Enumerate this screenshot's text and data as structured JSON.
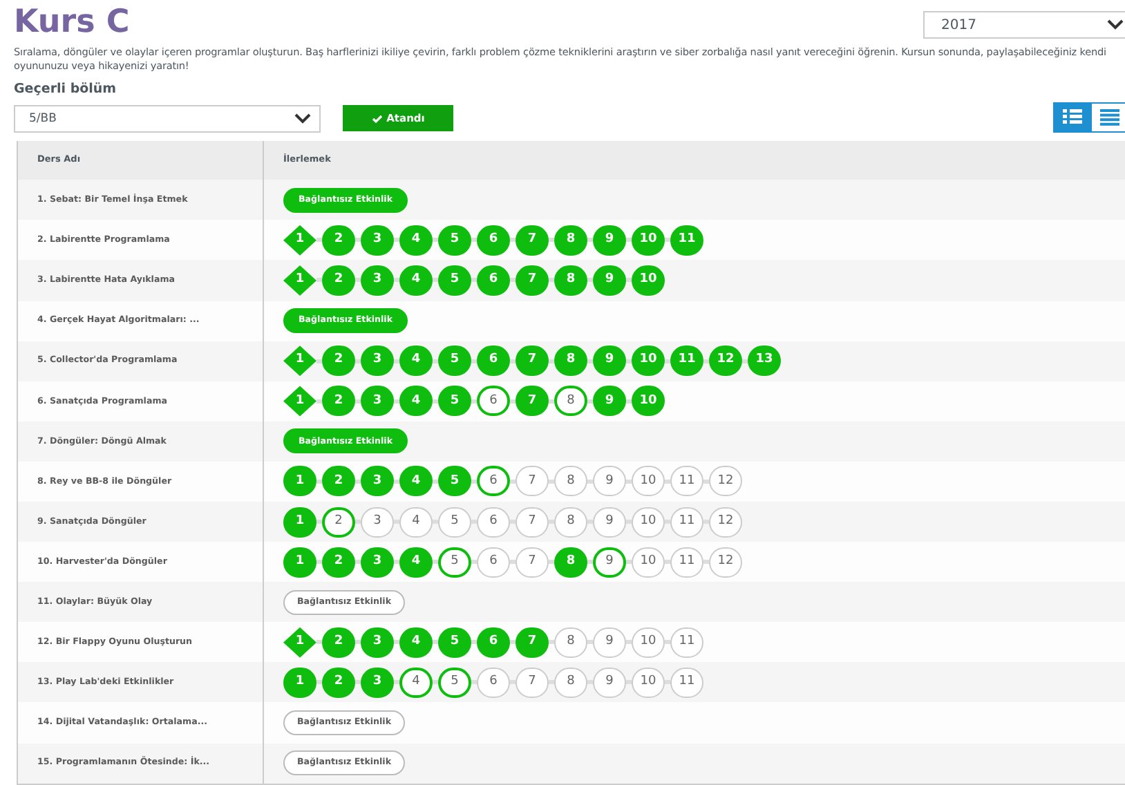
{
  "title": "Kurs C",
  "year_select": {
    "value": "2017"
  },
  "description": "Sıralama, döngüler ve olaylar içeren programlar oluşturun. Baş harflerinizi ikiliye çevirin, farklı problem çözme tekniklerini araştırın ve siber zorbalığa nasıl yanıt vereceğini öğrenin. Kursun sonunda, paylaşabileceğiniz kendi oyununuzu veya hikayenizi yaratın!",
  "section_label": "Geçerli bölüm",
  "section_select": {
    "value": "5/BB"
  },
  "assigned_button": {
    "label": "Atandı"
  },
  "view_toggle": [
    {
      "kind": "detail",
      "selected": true
    },
    {
      "kind": "summary",
      "selected": false
    }
  ],
  "table": {
    "columns": [
      "Ders Adı",
      "İlerlemek"
    ],
    "rows": [
      {
        "name": "1. Sebat: Bir Temel İnşa Etmek",
        "unplugged": {
          "label": "Bağlantısız Etkinlik",
          "completed": true
        }
      },
      {
        "name": "2. Labirentte Programlama",
        "levels": [
          {
            "label": "1",
            "kind": "diamond",
            "completed": true,
            "started": true
          },
          {
            "label": "2",
            "kind": "circle",
            "completed": true,
            "started": true
          },
          {
            "label": "3",
            "kind": "circle",
            "completed": true,
            "started": true
          },
          {
            "label": "4",
            "kind": "circle",
            "completed": true,
            "started": true
          },
          {
            "label": "5",
            "kind": "circle",
            "completed": true,
            "started": true
          },
          {
            "label": "6",
            "kind": "circle",
            "completed": true,
            "started": true
          },
          {
            "label": "7",
            "kind": "circle",
            "completed": true,
            "started": true
          },
          {
            "label": "8",
            "kind": "circle",
            "completed": true,
            "started": true
          },
          {
            "label": "9",
            "kind": "circle",
            "completed": true,
            "started": true
          },
          {
            "label": "10",
            "kind": "circle",
            "completed": true,
            "started": true
          },
          {
            "label": "11",
            "kind": "circle",
            "completed": true,
            "started": true
          }
        ]
      },
      {
        "name": "3. Labirentte Hata Ayıklama",
        "levels": [
          {
            "label": "1",
            "kind": "diamond",
            "completed": true,
            "started": true
          },
          {
            "label": "2",
            "kind": "circle",
            "completed": true,
            "started": true
          },
          {
            "label": "3",
            "kind": "circle",
            "completed": true,
            "started": true
          },
          {
            "label": "4",
            "kind": "circle",
            "completed": true,
            "started": true
          },
          {
            "label": "5",
            "kind": "circle",
            "completed": true,
            "started": true
          },
          {
            "label": "6",
            "kind": "circle",
            "completed": true,
            "started": true
          },
          {
            "label": "7",
            "kind": "circle",
            "completed": true,
            "started": true
          },
          {
            "label": "8",
            "kind": "circle",
            "completed": true,
            "started": true
          },
          {
            "label": "9",
            "kind": "circle",
            "completed": true,
            "started": true
          },
          {
            "label": "10",
            "kind": "circle",
            "completed": true,
            "started": true
          }
        ]
      },
      {
        "name": "4. Gerçek Hayat Algoritmaları: ...",
        "unplugged": {
          "label": "Bağlantısız Etkinlik",
          "completed": true
        }
      },
      {
        "name": "5. Collector'da Programlama",
        "levels": [
          {
            "label": "1",
            "kind": "diamond",
            "completed": true,
            "started": true
          },
          {
            "label": "2",
            "kind": "circle",
            "completed": true,
            "started": true
          },
          {
            "label": "3",
            "kind": "circle",
            "completed": true,
            "started": true
          },
          {
            "label": "4",
            "kind": "circle",
            "completed": true,
            "started": true
          },
          {
            "label": "5",
            "kind": "circle",
            "completed": true,
            "started": true
          },
          {
            "label": "6",
            "kind": "circle",
            "completed": true,
            "started": true
          },
          {
            "label": "7",
            "kind": "circle",
            "completed": true,
            "started": true
          },
          {
            "label": "8",
            "kind": "circle",
            "completed": true,
            "started": true
          },
          {
            "label": "9",
            "kind": "circle",
            "completed": true,
            "started": true
          },
          {
            "label": "10",
            "kind": "circle",
            "completed": true,
            "started": true
          },
          {
            "label": "11",
            "kind": "circle",
            "completed": true,
            "started": true
          },
          {
            "label": "12",
            "kind": "circle",
            "completed": true,
            "started": true
          },
          {
            "label": "13",
            "kind": "circle",
            "completed": true,
            "started": true
          }
        ]
      },
      {
        "name": "6. Sanatçıda Programlama",
        "levels": [
          {
            "label": "1",
            "kind": "diamond",
            "completed": true,
            "started": true
          },
          {
            "label": "2",
            "kind": "circle",
            "completed": true,
            "started": true
          },
          {
            "label": "3",
            "kind": "circle",
            "completed": true,
            "started": true
          },
          {
            "label": "4",
            "kind": "circle",
            "completed": true,
            "started": true
          },
          {
            "label": "5",
            "kind": "circle",
            "completed": true,
            "started": true
          },
          {
            "label": "6",
            "kind": "circle",
            "completed": false,
            "started": true
          },
          {
            "label": "7",
            "kind": "circle",
            "completed": true,
            "started": true
          },
          {
            "label": "8",
            "kind": "circle",
            "completed": false,
            "started": true
          },
          {
            "label": "9",
            "kind": "circle",
            "completed": true,
            "started": true
          },
          {
            "label": "10",
            "kind": "circle",
            "completed": true,
            "started": true
          }
        ]
      },
      {
        "name": "7. Döngüler: Döngü Almak",
        "unplugged": {
          "label": "Bağlantısız Etkinlik",
          "completed": true
        }
      },
      {
        "name": "8. Rey ve BB-8 ile Döngüler",
        "levels": [
          {
            "label": "1",
            "kind": "circle",
            "completed": true,
            "started": true
          },
          {
            "label": "2",
            "kind": "circle",
            "completed": true,
            "started": true
          },
          {
            "label": "3",
            "kind": "circle",
            "completed": true,
            "started": true
          },
          {
            "label": "4",
            "kind": "circle",
            "completed": true,
            "started": true
          },
          {
            "label": "5",
            "kind": "circle",
            "completed": true,
            "started": true
          },
          {
            "label": "6",
            "kind": "circle",
            "completed": false,
            "started": true
          },
          {
            "label": "7",
            "kind": "circle",
            "completed": false,
            "started": false
          },
          {
            "label": "8",
            "kind": "circle",
            "completed": false,
            "started": false
          },
          {
            "label": "9",
            "kind": "circle",
            "completed": false,
            "started": false
          },
          {
            "label": "10",
            "kind": "circle",
            "completed": false,
            "started": false
          },
          {
            "label": "11",
            "kind": "circle",
            "completed": false,
            "started": false
          },
          {
            "label": "12",
            "kind": "circle",
            "completed": false,
            "started": false
          }
        ]
      },
      {
        "name": "9. Sanatçıda Döngüler",
        "levels": [
          {
            "label": "1",
            "kind": "circle",
            "completed": true,
            "started": true
          },
          {
            "label": "2",
            "kind": "circle",
            "completed": false,
            "started": true
          },
          {
            "label": "3",
            "kind": "circle",
            "completed": false,
            "started": false
          },
          {
            "label": "4",
            "kind": "circle",
            "completed": false,
            "started": false
          },
          {
            "label": "5",
            "kind": "circle",
            "completed": false,
            "started": false
          },
          {
            "label": "6",
            "kind": "circle",
            "completed": false,
            "started": false
          },
          {
            "label": "7",
            "kind": "circle",
            "completed": false,
            "started": false
          },
          {
            "label": "8",
            "kind": "circle",
            "completed": false,
            "started": false
          },
          {
            "label": "9",
            "kind": "circle",
            "completed": false,
            "started": false
          },
          {
            "label": "10",
            "kind": "circle",
            "completed": false,
            "started": false
          },
          {
            "label": "11",
            "kind": "circle",
            "completed": false,
            "started": false
          },
          {
            "label": "12",
            "kind": "circle",
            "completed": false,
            "started": false
          }
        ]
      },
      {
        "name": "10. Harvester'da Döngüler",
        "levels": [
          {
            "label": "1",
            "kind": "circle",
            "completed": true,
            "started": true
          },
          {
            "label": "2",
            "kind": "circle",
            "completed": true,
            "started": true
          },
          {
            "label": "3",
            "kind": "circle",
            "completed": true,
            "started": true
          },
          {
            "label": "4",
            "kind": "circle",
            "completed": true,
            "started": true
          },
          {
            "label": "5",
            "kind": "circle",
            "completed": false,
            "started": true
          },
          {
            "label": "6",
            "kind": "circle",
            "completed": false,
            "started": false
          },
          {
            "label": "7",
            "kind": "circle",
            "completed": false,
            "started": false
          },
          {
            "label": "8",
            "kind": "circle",
            "completed": true,
            "started": true
          },
          {
            "label": "9",
            "kind": "circle",
            "completed": false,
            "started": true
          },
          {
            "label": "10",
            "kind": "circle",
            "completed": false,
            "started": false
          },
          {
            "label": "11",
            "kind": "circle",
            "completed": false,
            "started": false
          },
          {
            "label": "12",
            "kind": "circle",
            "completed": false,
            "started": false
          }
        ]
      },
      {
        "name": "11. Olaylar: Büyük Olay",
        "unplugged": {
          "label": "Bağlantısız Etkinlik",
          "completed": false
        }
      },
      {
        "name": "12. Bir Flappy Oyunu Oluşturun",
        "levels": [
          {
            "label": "1",
            "kind": "diamond",
            "completed": true,
            "started": true
          },
          {
            "label": "2",
            "kind": "circle",
            "completed": true,
            "started": true
          },
          {
            "label": "3",
            "kind": "circle",
            "completed": true,
            "started": true
          },
          {
            "label": "4",
            "kind": "circle",
            "completed": true,
            "started": true
          },
          {
            "label": "5",
            "kind": "circle",
            "completed": true,
            "started": true
          },
          {
            "label": "6",
            "kind": "circle",
            "completed": true,
            "started": true
          },
          {
            "label": "7",
            "kind": "circle",
            "completed": true,
            "started": true
          },
          {
            "label": "8",
            "kind": "circle",
            "completed": false,
            "started": false
          },
          {
            "label": "9",
            "kind": "circle",
            "completed": false,
            "started": false
          },
          {
            "label": "10",
            "kind": "circle",
            "completed": false,
            "started": false
          },
          {
            "label": "11",
            "kind": "circle",
            "completed": false,
            "started": false
          }
        ]
      },
      {
        "name": "13. Play Lab'deki Etkinlikler",
        "levels": [
          {
            "label": "1",
            "kind": "circle",
            "completed": true,
            "started": true
          },
          {
            "label": "2",
            "kind": "circle",
            "completed": true,
            "started": true
          },
          {
            "label": "3",
            "kind": "circle",
            "completed": true,
            "started": true
          },
          {
            "label": "4",
            "kind": "circle",
            "completed": false,
            "started": true
          },
          {
            "label": "5",
            "kind": "circle",
            "completed": false,
            "started": true
          },
          {
            "label": "6",
            "kind": "circle",
            "completed": false,
            "started": false
          },
          {
            "label": "7",
            "kind": "circle",
            "completed": false,
            "started": false
          },
          {
            "label": "8",
            "kind": "circle",
            "completed": false,
            "started": false
          },
          {
            "label": "9",
            "kind": "circle",
            "completed": false,
            "started": false
          },
          {
            "label": "10",
            "kind": "circle",
            "completed": false,
            "started": false
          },
          {
            "label": "11",
            "kind": "circle",
            "completed": false,
            "started": false
          }
        ]
      },
      {
        "name": "14. Dijital Vatandaşlık: Ortalama...",
        "unplugged": {
          "label": "Bağlantısız Etkinlik",
          "completed": false
        }
      },
      {
        "name": "15. Programlamanın Ötesinde: İk...",
        "unplugged": {
          "label": "Bağlantısız Etkinlik",
          "completed": false
        }
      }
    ]
  }
}
